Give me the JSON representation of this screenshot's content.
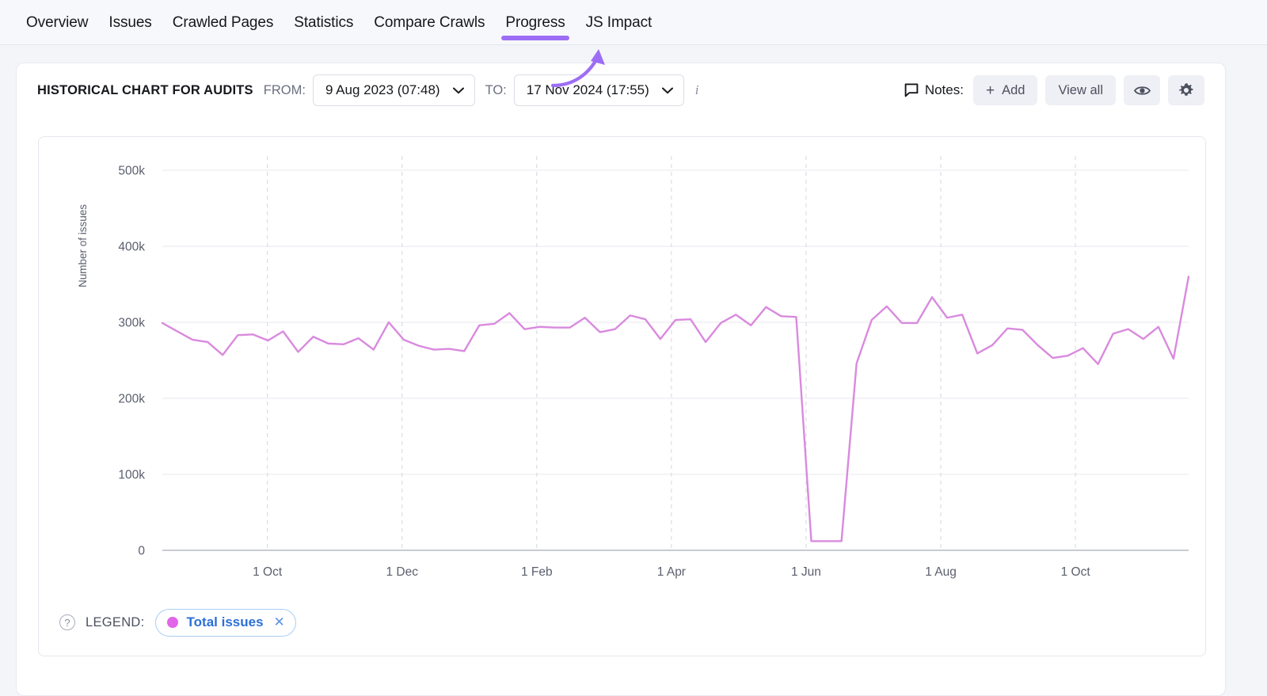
{
  "nav": {
    "tabs": [
      {
        "label": "Overview",
        "active": false
      },
      {
        "label": "Issues",
        "active": false
      },
      {
        "label": "Crawled Pages",
        "active": false
      },
      {
        "label": "Statistics",
        "active": false
      },
      {
        "label": "Compare Crawls",
        "active": false
      },
      {
        "label": "Progress",
        "active": true
      },
      {
        "label": "JS Impact",
        "active": false
      }
    ],
    "active_tab": "Progress",
    "active_underline_color": "#9d6ef5",
    "annotation_arrow_color": "#9d6ef5"
  },
  "panel": {
    "title": "HISTORICAL CHART FOR AUDITS",
    "from_label": "FROM:",
    "from_value": "9 Aug 2023 (07:48)",
    "to_label": "TO:",
    "to_value": "17 Nov 2024 (17:55)",
    "info_icon": "info-italic-i-icon",
    "notes_label": "Notes:",
    "notes_icon": "comment-icon",
    "add_button": "Add",
    "add_icon": "plus-icon",
    "view_all_button": "View all",
    "eye_icon": "eye-icon",
    "settings_icon": "gear-icon"
  },
  "legend": {
    "help_icon": "question-mark-icon",
    "title": "LEGEND:",
    "series_label": "Total issues",
    "series_color": "#e264e8",
    "remove_icon": "close-x-icon",
    "pill_text_color": "#2c6fd8",
    "pill_border_color": "#a9cef5"
  },
  "chart_data": {
    "type": "line",
    "title": "HISTORICAL CHART FOR AUDITS",
    "xlabel": "",
    "ylabel": "Number of issues",
    "ylim": [
      0,
      500000
    ],
    "ytick_values": [
      0,
      100000,
      200000,
      300000,
      400000,
      500000
    ],
    "ytick_labels": [
      "0",
      "100k",
      "200k",
      "300k",
      "400k",
      "500k"
    ],
    "xtick_labels": [
      "1 Oct",
      "1 Dec",
      "1 Feb",
      "1 Apr",
      "1 Jun",
      "1 Aug",
      "1 Oct"
    ],
    "x_range": [
      "9 Aug 2023 (07:48)",
      "17 Nov 2024 (17:55)"
    ],
    "grid": "horizontal solid + vertical dashed at x ticks",
    "legend_position": "bottom-left",
    "series": [
      {
        "name": "Total issues",
        "color": "#d98ade",
        "line_width": 2.4,
        "x": [
          "2023-08-09",
          "2023-08-17",
          "2023-08-25",
          "2023-09-02",
          "2023-09-10",
          "2023-09-18",
          "2023-09-26",
          "2023-10-04",
          "2023-10-12",
          "2023-10-20",
          "2023-10-28",
          "2023-11-05",
          "2023-11-13",
          "2023-11-21",
          "2023-11-29",
          "2023-12-07",
          "2023-12-15",
          "2023-12-23",
          "2023-12-31",
          "2024-01-08",
          "2024-01-16",
          "2024-01-24",
          "2024-02-01",
          "2024-02-09",
          "2024-02-17",
          "2024-02-25",
          "2024-03-04",
          "2024-03-12",
          "2024-03-20",
          "2024-03-28",
          "2024-04-05",
          "2024-04-13",
          "2024-04-21",
          "2024-04-29",
          "2024-05-07",
          "2024-05-15",
          "2024-05-19",
          "2024-05-23",
          "2024-06-04",
          "2024-06-08",
          "2024-06-16",
          "2024-06-24",
          "2024-07-02",
          "2024-07-10",
          "2024-07-18",
          "2024-07-26",
          "2024-08-03",
          "2024-08-11",
          "2024-08-19",
          "2024-08-27",
          "2024-09-04",
          "2024-09-12",
          "2024-09-20",
          "2024-09-28",
          "2024-10-06",
          "2024-10-14",
          "2024-10-22",
          "2024-10-30",
          "2024-11-07",
          "2024-11-13",
          "2024-11-17"
        ],
        "values": [
          299000,
          288000,
          277000,
          274000,
          257000,
          283000,
          284000,
          276000,
          288000,
          261000,
          281000,
          272000,
          271000,
          279000,
          264000,
          300000,
          277000,
          269000,
          264000,
          265000,
          262000,
          296000,
          298000,
          312000,
          291000,
          294000,
          293000,
          293000,
          306000,
          287000,
          291000,
          309000,
          304000,
          278000,
          303000,
          304000,
          274000,
          299000,
          310000,
          296000,
          320000,
          308000,
          307000,
          12000,
          12000,
          12000,
          246000,
          303000,
          321000,
          299000,
          299000,
          333000,
          306000,
          310000,
          259000,
          270000,
          292000,
          290000,
          270000,
          253000,
          256000,
          266000,
          245000,
          285000,
          291000,
          278000,
          294000,
          252000,
          360000
        ]
      }
    ]
  }
}
